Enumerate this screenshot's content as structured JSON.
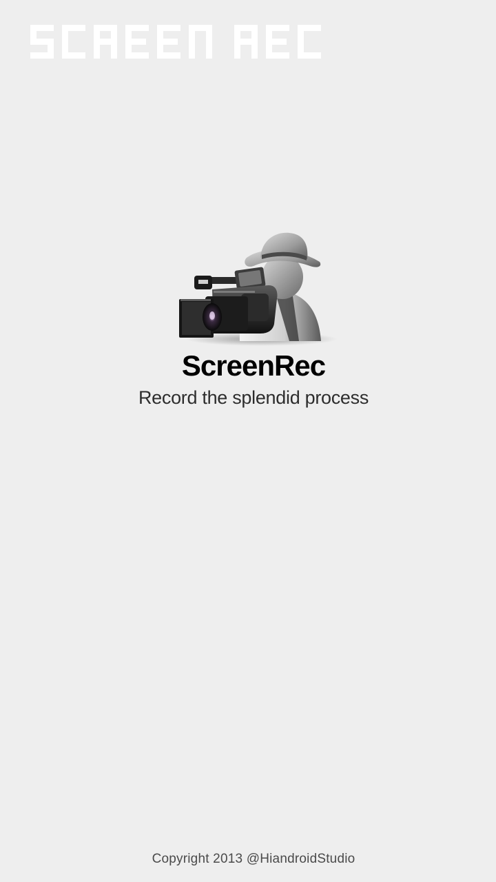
{
  "splash": {
    "watermark_text": "SCREEN REC",
    "app_name": "ScreenRec",
    "tagline": "Record the splendid process",
    "copyright": "Copyright 2013 @HiandroidStudio"
  },
  "icons": {
    "logo": "camcorder-person-icon"
  },
  "colors": {
    "background": "#eeeeee",
    "watermark": "#ffffff",
    "app_name": "#000000",
    "tagline": "#2d2d2d",
    "copyright": "#4a4a4a"
  }
}
